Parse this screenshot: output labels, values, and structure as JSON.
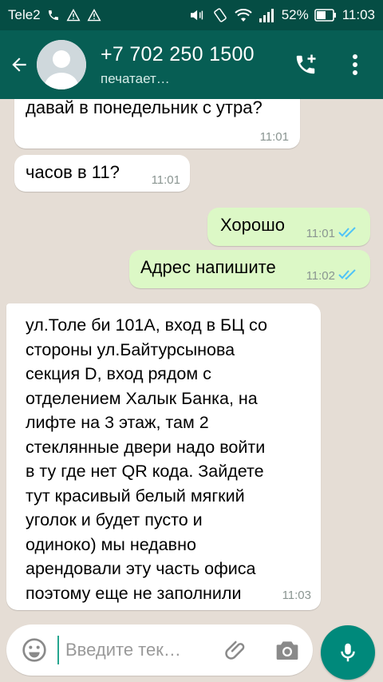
{
  "status_bar": {
    "carrier": "Tele2",
    "battery": "52%",
    "time": "11:03",
    "icons": [
      "phone-icon",
      "warning-icon",
      "warning-icon",
      "volume-vibrate-icon",
      "rotation-icon",
      "wifi-icon",
      "signal-icon",
      "battery-icon"
    ]
  },
  "header": {
    "contact_name": "+7 702 250 1500",
    "status": "печатает…",
    "icons": {
      "back": "arrow-back-icon",
      "avatar": "default-avatar-icon",
      "call": "add-call-icon",
      "menu": "more-vertical-icon"
    }
  },
  "messages": [
    {
      "direction": "in",
      "text": "давай в понедельник с утра?",
      "time": "11:01"
    },
    {
      "direction": "in",
      "text": "часов в 11?",
      "time": "11:01"
    },
    {
      "direction": "out",
      "text": "Хорошо",
      "time": "11:01",
      "read": true
    },
    {
      "direction": "out",
      "text": "Адрес напишите",
      "time": "11:02",
      "read": true
    },
    {
      "direction": "in",
      "text": "ул.Толе би 101А, вход в БЦ со\nстороны ул.Байтурсынова\nсекция D, вход рядом с\nотделением Халык Банка, на\nлифте на 3 этаж, там 2\nстеклянные двери надо войти\nв ту где нет QR кода. Зайдете\nтут красивый белый мягкий\nуголок и будет пусто и\nодиноко) мы недавно\nарендовали эту часть офиса\nпоэтому еще не заполнили",
      "time": "11:03"
    }
  ],
  "input": {
    "placeholder": "Введите тек…",
    "value": ""
  },
  "colors": {
    "status_bar": "#054d44",
    "app_bar": "#075e54",
    "chat_bg": "#e5ddd5",
    "outgoing_bubble": "#dcf8c6",
    "incoming_bubble": "#ffffff",
    "read_ticks": "#4fc3f7",
    "mic_button": "#00897b"
  }
}
